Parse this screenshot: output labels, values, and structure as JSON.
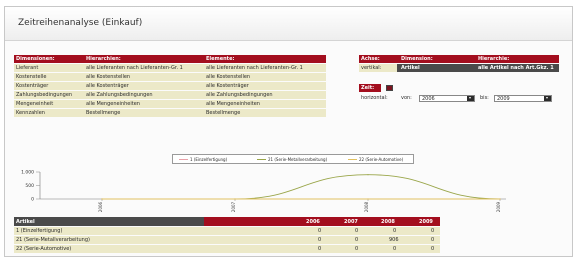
{
  "window": {
    "title": "Zeitreihenanalyse (Einkauf)"
  },
  "dimensions": {
    "headers": [
      "Dimensionen:",
      "Hierarchien:",
      "Elemente:"
    ],
    "rows": [
      [
        "Lieferant",
        "alle Lieferanten nach Lieferanten-Gr. 1",
        "alle Lieferanten nach Lieferanten-Gr. 1"
      ],
      [
        "Kostenstelle",
        "alle Kostenstellen",
        "alle Kostenstellen"
      ],
      [
        "Kostenträger",
        "alle Kostenträger",
        "alle Kostenträger"
      ],
      [
        "Zahlungsbedingungen",
        "alle Zahlungsbedingungen",
        "alle Zahlungsbedingungen"
      ],
      [
        "Mengeneinheit",
        "alle Mengeneinheiten",
        "alle Mengeneinheiten"
      ],
      [
        "Kennzahlen",
        "Bestellmenge",
        "Bestellmenge"
      ]
    ]
  },
  "axes_panel": {
    "headers": [
      "Achse:",
      "Dimension:",
      "Hierarchie:"
    ],
    "row": [
      "vertikal:",
      "Artikel",
      "alle Artikel nach Art.Gkz. 1"
    ]
  },
  "time_panel": {
    "label": "Zeit:",
    "horizontal_label": "horizontal:",
    "from_label": "von:",
    "from_value": "2006",
    "to_label": "bis:",
    "to_value": "2009"
  },
  "chart_data": {
    "type": "line",
    "x": [
      "2006",
      "2007",
      "2008",
      "2009"
    ],
    "yticks": [
      "1.000",
      "500",
      "0"
    ],
    "ylim": [
      0,
      1000
    ],
    "series": [
      {
        "name": "1 (Einzelfertigung)",
        "color": "#e8a0a8",
        "values": [
          0,
          0,
          0,
          0
        ]
      },
      {
        "name": "21 (Serie-Metallverarbeitung)",
        "color": "#9aa64a",
        "values": [
          0,
          0,
          900,
          0
        ]
      },
      {
        "name": "22 (Serie-Automotive)",
        "color": "#e0c060",
        "values": [
          0,
          0,
          0,
          0
        ]
      }
    ],
    "legend": "top",
    "grid": false
  },
  "table": {
    "header_label": "Artikel",
    "years": [
      "2006",
      "2007",
      "2008",
      "2009"
    ],
    "rows": [
      {
        "label": "1 (Einzelfertigung)",
        "values": [
          "0",
          "0",
          "0",
          "0"
        ]
      },
      {
        "label": "21 (Serie-Metallverarbeitung)",
        "values": [
          "0",
          "0",
          "906",
          "0"
        ]
      },
      {
        "label": "22 (Serie-Automotive)",
        "values": [
          "0",
          "0",
          "0",
          "0"
        ]
      }
    ]
  },
  "colors": {
    "header_red": "#a30e1e",
    "row_beige": "#ece9c8",
    "dark_bar": "#4a4a4a"
  }
}
